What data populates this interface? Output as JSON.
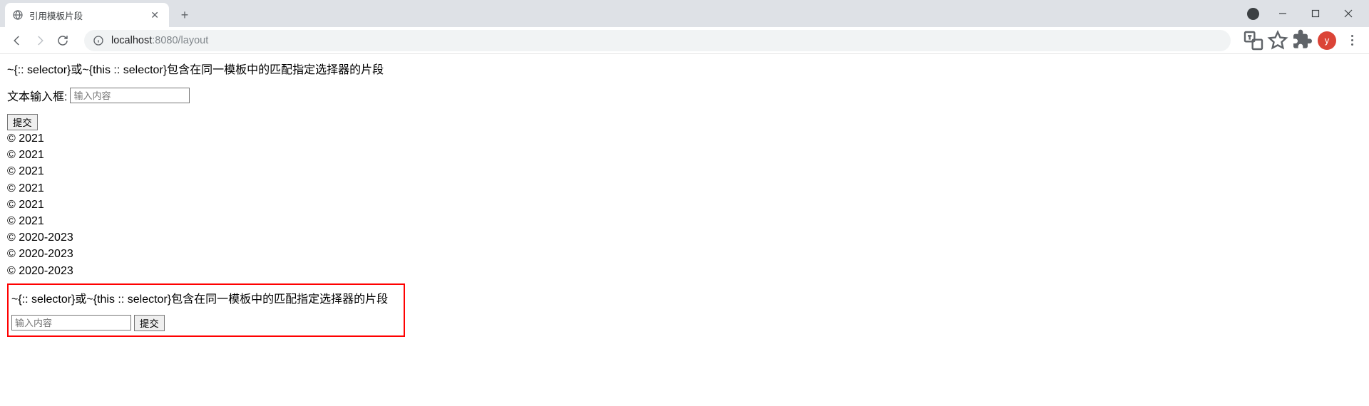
{
  "browser": {
    "tab_title": "引用模板片段",
    "url_host": "localhost",
    "url_port_path": ":8080/layout",
    "avatar_letter": "y"
  },
  "page": {
    "heading": "~{:: selector}或~{this :: selector}包含在同一模板中的匹配指定选择器的片段",
    "form": {
      "label": "文本输入框: ",
      "placeholder": "输入内容",
      "submit_label": "提交"
    },
    "copyrights": [
      "© 2021",
      "© 2021",
      "© 2021",
      "© 2021",
      "© 2021",
      "© 2021",
      "© 2020-2023",
      "© 2020-2023",
      "© 2020-2023"
    ],
    "red_box": {
      "heading": "~{:: selector}或~{this :: selector}包含在同一模板中的匹配指定选择器的片段",
      "placeholder": "输入内容",
      "submit_label": "提交"
    }
  }
}
